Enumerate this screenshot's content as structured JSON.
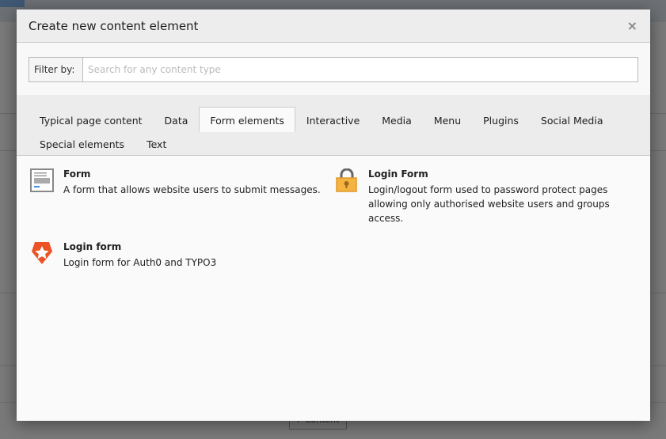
{
  "background": {
    "content_button": "Content"
  },
  "modal": {
    "title": "Create new content element",
    "close_label": "×",
    "filter": {
      "label": "Filter by:",
      "placeholder": "Search for any content type",
      "value": ""
    },
    "tabs": [
      {
        "label": "Typical page content",
        "active": false
      },
      {
        "label": "Data",
        "active": false
      },
      {
        "label": "Form elements",
        "active": true
      },
      {
        "label": "Interactive",
        "active": false
      },
      {
        "label": "Media",
        "active": false
      },
      {
        "label": "Menu",
        "active": false
      },
      {
        "label": "Plugins",
        "active": false
      },
      {
        "label": "Social Media",
        "active": false
      },
      {
        "label": "Special elements",
        "active": false
      },
      {
        "label": "Text",
        "active": false
      }
    ],
    "items": [
      {
        "name": "Form",
        "description": "A form that allows website users to submit messages.",
        "icon": "form-icon"
      },
      {
        "name": "Login Form",
        "description": "Login/logout form used to password protect pages allowing only authorised website users and groups access.",
        "icon": "lock-icon"
      },
      {
        "name": "Login form",
        "description": "Login form for Auth0 and TYPO3",
        "icon": "auth0-icon"
      }
    ]
  },
  "colors": {
    "lock": "#f5b342",
    "auth0": "#eb5424",
    "overlay": "#7a7a7a"
  }
}
